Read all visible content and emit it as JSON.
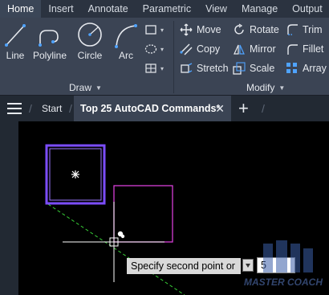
{
  "ribbon_tabs": [
    "Home",
    "Insert",
    "Annotate",
    "Parametric",
    "View",
    "Manage",
    "Output"
  ],
  "draw_panel": {
    "title": "Draw",
    "tools": [
      {
        "label": "Line",
        "icon": "line-icon"
      },
      {
        "label": "Polyline",
        "icon": "polyline-icon"
      },
      {
        "label": "Circle",
        "icon": "circle-icon"
      },
      {
        "label": "Arc",
        "icon": "arc-icon"
      }
    ],
    "mini_tools": [
      "rectangle-icon",
      "hatch-icon",
      "table-grid-icon"
    ]
  },
  "modify_panel": {
    "title": "Modify",
    "tools": [
      {
        "label": "Move",
        "icon": "move-icon"
      },
      {
        "label": "Rotate",
        "icon": "rotate-icon"
      },
      {
        "label": "Trim",
        "icon": "trim-icon"
      },
      {
        "label": "Copy",
        "icon": "copy-icon"
      },
      {
        "label": "Mirror",
        "icon": "mirror-icon"
      },
      {
        "label": "Fillet",
        "icon": "fillet-icon"
      },
      {
        "label": "Stretch",
        "icon": "stretch-icon"
      },
      {
        "label": "Scale",
        "icon": "scale-icon"
      },
      {
        "label": "Array",
        "icon": "array-icon"
      }
    ]
  },
  "file_tabs": {
    "start": "Start",
    "active": "Top 25 AutoCAD Commands*",
    "close": "✕",
    "add": "+"
  },
  "command": {
    "prompt": "Specify second point or",
    "input_value": "5"
  },
  "logo_text": "MASTER COACH",
  "colors": {
    "ribbon_bg": "#3b4454",
    "tab_bar_bg": "#2b3340",
    "canvas_bg": "#000000",
    "selected_square": "#7b4dff",
    "moving_square": "#d63fd6",
    "tracking_line": "#38d138"
  }
}
